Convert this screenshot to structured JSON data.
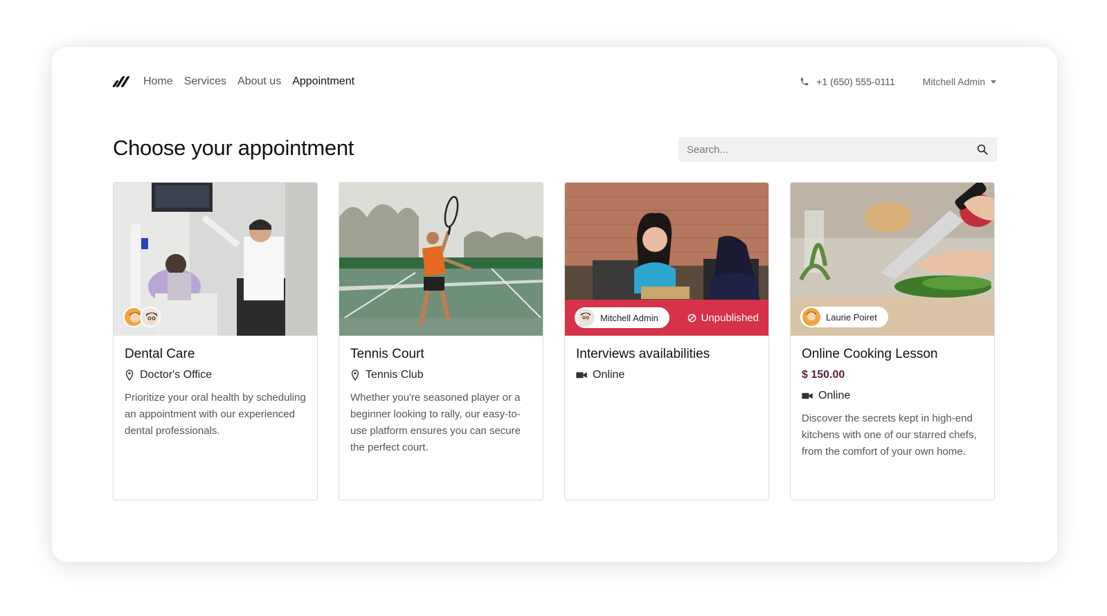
{
  "nav": {
    "links": [
      "Home",
      "Services",
      "About us",
      "Appointment"
    ],
    "active_index": 3,
    "phone": "+1 (650) 555-0111",
    "user": "Mitchell Admin"
  },
  "page": {
    "title": "Choose your appointment",
    "search_placeholder": "Search..."
  },
  "cards": [
    {
      "title": "Dental Care",
      "location": "Doctor's Office",
      "description": "Prioritize your oral health by scheduling an appointment with our experienced dental professionals."
    },
    {
      "title": "Tennis Court",
      "location": "Tennis Club",
      "description": "Whether you're seasoned player or a beginner looking to rally, our easy-to-use platform ensures you can secure the perfect court."
    },
    {
      "title": "Interviews availabilities",
      "mode": "Online",
      "staff": "Mitchell Admin",
      "status": "Unpublished"
    },
    {
      "title": "Online Cooking Lesson",
      "price": "$ 150.00",
      "mode": "Online",
      "staff": "Laurie Poiret",
      "description": "Discover the secrets kept in high-end kitchens with one of our starred chefs, from the comfort of your own home."
    }
  ],
  "colors": {
    "accent_red": "#d6324a",
    "price": "#5b1e3d"
  }
}
